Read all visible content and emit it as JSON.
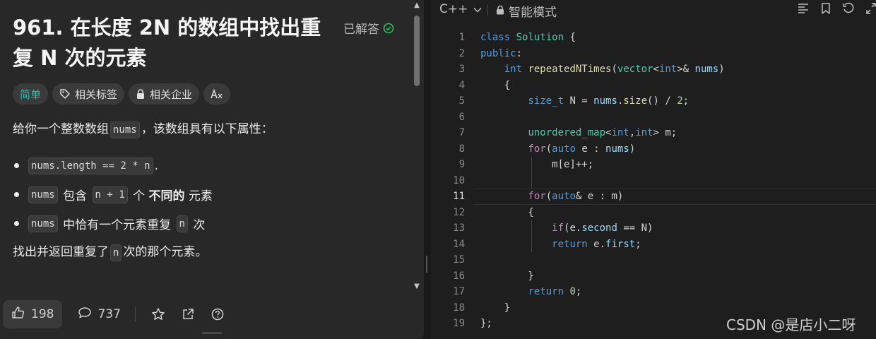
{
  "problem": {
    "title": "961. 在长度 2N 的数组中找出重复 N 次的元素",
    "status": "已解答",
    "tags": [
      {
        "label": "简单",
        "icon": "difficulty"
      },
      {
        "label": "相关标签",
        "icon": "tag-icon"
      },
      {
        "label": "相关企业",
        "icon": "lock-icon"
      },
      {
        "label": "",
        "icon": "translate-icon"
      }
    ],
    "intro_prefix": "给你一个整数数组",
    "intro_code": "nums",
    "intro_suffix": "，该数组具有以下属性：",
    "bullets": [
      {
        "code": "nums.length == 2 * n",
        "text": "."
      },
      {
        "code": "nums",
        "mid": "包含",
        "code2": "n + 1",
        "text_a": "个",
        "strong": "不同的",
        "text_b": "元素"
      },
      {
        "code": "nums",
        "mid": "中恰有一个元素重复",
        "code2": "n",
        "text_b": "次"
      }
    ],
    "final_prefix": "找出并返回重复了",
    "final_code": "n",
    "final_suffix": "次的那个元素。"
  },
  "bottom_bar": {
    "likes": "198",
    "comments": "737"
  },
  "editor": {
    "language": "C++",
    "mode": "智能模式",
    "active_line": 11,
    "lines": [
      "class Solution {",
      "public:",
      "    int repeatedNTimes(vector<int>& nums)",
      "    {",
      "        size_t N = nums.size() / 2;",
      "",
      "        unordered_map<int,int> m;",
      "        for(auto e : nums)",
      "            m[e]++;",
      "",
      "        for(auto& e : m)",
      "        {",
      "            if(e.second == N)",
      "            return e.first;",
      "",
      "        }",
      "        return 0;",
      "    }",
      "};"
    ]
  },
  "watermark": "CSDN @是店小二呀",
  "colors": {
    "easy": "#21c4b1",
    "solved_check": "#2cbb5d",
    "keyword": "#569cd6",
    "type": "#4ec9b0",
    "function": "#dcdcaa",
    "variable": "#9cdcfe",
    "number": "#b5cea8",
    "control": "#c586c0"
  }
}
